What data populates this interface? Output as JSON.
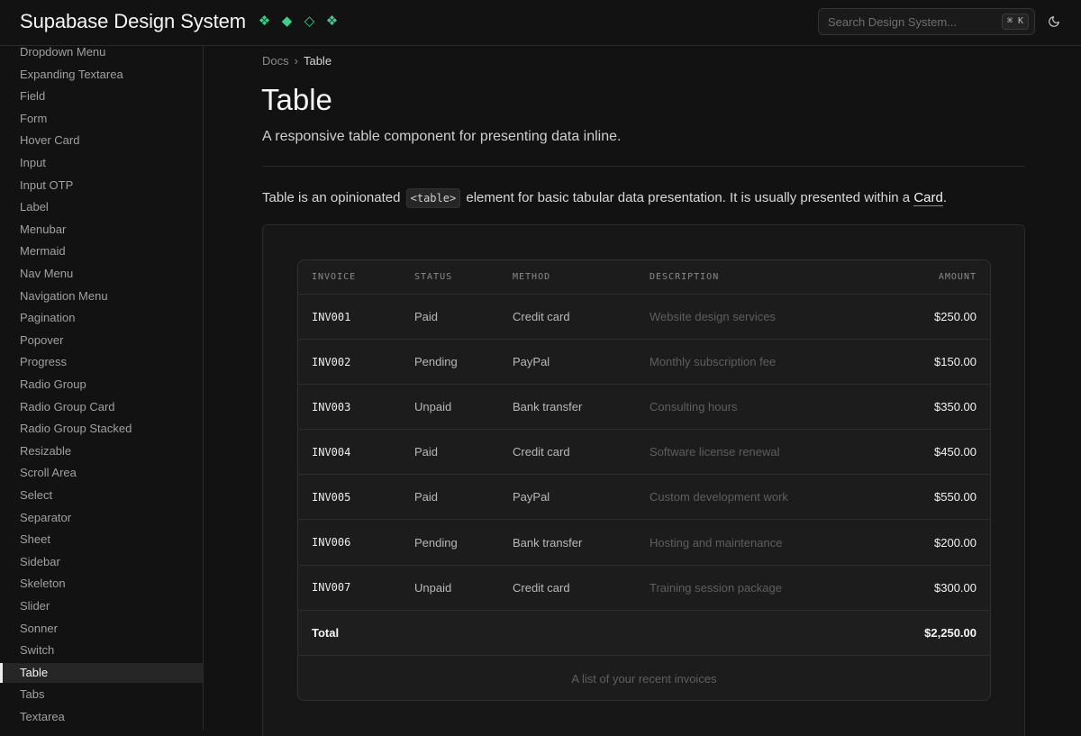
{
  "header": {
    "brand": "Supabase Design System",
    "search_placeholder": "Search Design System...",
    "search_shortcut": "⌘ K",
    "accent_color": "#3ecf8e"
  },
  "sidebar": {
    "items": [
      {
        "label": "Dropdown Menu"
      },
      {
        "label": "Expanding Textarea"
      },
      {
        "label": "Field"
      },
      {
        "label": "Form"
      },
      {
        "label": "Hover Card"
      },
      {
        "label": "Input"
      },
      {
        "label": "Input OTP"
      },
      {
        "label": "Label"
      },
      {
        "label": "Menubar"
      },
      {
        "label": "Mermaid"
      },
      {
        "label": "Nav Menu"
      },
      {
        "label": "Navigation Menu"
      },
      {
        "label": "Pagination"
      },
      {
        "label": "Popover"
      },
      {
        "label": "Progress"
      },
      {
        "label": "Radio Group"
      },
      {
        "label": "Radio Group Card"
      },
      {
        "label": "Radio Group Stacked"
      },
      {
        "label": "Resizable"
      },
      {
        "label": "Scroll Area"
      },
      {
        "label": "Select"
      },
      {
        "label": "Separator"
      },
      {
        "label": "Sheet"
      },
      {
        "label": "Sidebar"
      },
      {
        "label": "Skeleton"
      },
      {
        "label": "Slider"
      },
      {
        "label": "Sonner"
      },
      {
        "label": "Switch"
      },
      {
        "label": "Table",
        "active": true
      },
      {
        "label": "Tabs"
      },
      {
        "label": "Textarea"
      }
    ]
  },
  "breadcrumb": {
    "root": "Docs",
    "separator": "›",
    "current": "Table"
  },
  "main": {
    "title": "Table",
    "subtitle": "A responsive table component for presenting data inline.",
    "intro_before": "Table is an opinionated ",
    "intro_code": "<table>",
    "intro_middle": " element for basic tabular data presentation. It is usually presented within a ",
    "intro_link": "Card",
    "intro_after": "."
  },
  "table": {
    "headers": [
      "INVOICE",
      "STATUS",
      "METHOD",
      "DESCRIPTION",
      "AMOUNT"
    ],
    "rows": [
      [
        "INV001",
        "Paid",
        "Credit card",
        "Website design services",
        "$250.00"
      ],
      [
        "INV002",
        "Pending",
        "PayPal",
        "Monthly subscription fee",
        "$150.00"
      ],
      [
        "INV003",
        "Unpaid",
        "Bank transfer",
        "Consulting hours",
        "$350.00"
      ],
      [
        "INV004",
        "Paid",
        "Credit card",
        "Software license renewal",
        "$450.00"
      ],
      [
        "INV005",
        "Paid",
        "PayPal",
        "Custom development work",
        "$550.00"
      ],
      [
        "INV006",
        "Pending",
        "Bank transfer",
        "Hosting and maintenance",
        "$200.00"
      ],
      [
        "INV007",
        "Unpaid",
        "Credit card",
        "Training session package",
        "$300.00"
      ]
    ],
    "footer_label": "Total",
    "footer_amount": "$2,250.00",
    "caption": "A list of your recent invoices"
  }
}
